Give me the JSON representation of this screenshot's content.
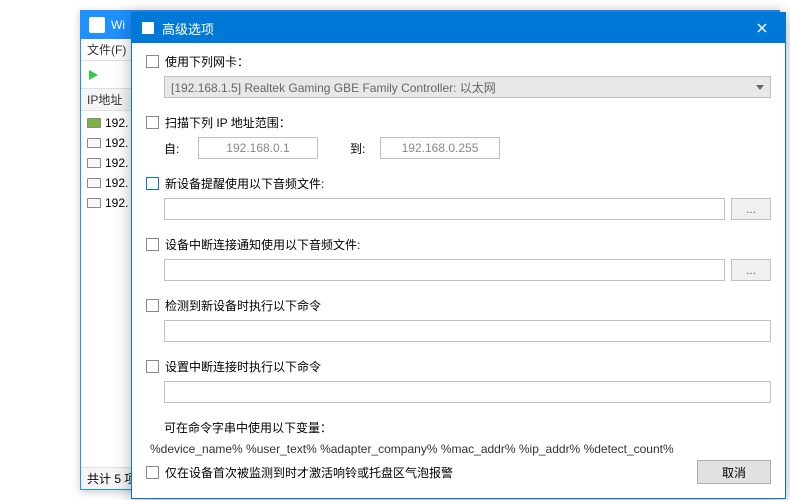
{
  "bg": {
    "title": "Wi",
    "menu": "文件(F)",
    "header": "IP地址",
    "rows": [
      "192.",
      "192.",
      "192.",
      "192.",
      "192."
    ],
    "status": "共计 5 项"
  },
  "dialog": {
    "title": "高级选项",
    "opts": {
      "useAdapter": "使用下列网卡：",
      "adapter": "[192.168.1.5]  Realtek Gaming GBE Family Controller:  以太网",
      "scanRange": "扫描下列 IP 地址范围：",
      "from": "自:",
      "fromVal": "192.168.0.1",
      "to": "到:",
      "toVal": "192.168.0.255",
      "newDevAudio": "新设备提醒使用以下音频文件:",
      "disconnectAudio": "设备中断连接通知使用以下音频文件:",
      "newDevCmd": "检测到新设备时执行以下命令",
      "disconnectCmd": "设置中断连接时执行以下命令",
      "varsLabel": "可在命令字串中使用以下变量：",
      "vars": "%device_name%  %user_text%  %adapter_company%  %mac_addr%  %ip_addr%  %detect_count%",
      "firstDetect": "仅在设备首次被监测到时才激活响铃或托盘区气泡报警"
    },
    "browse": "...",
    "cancel": "取消"
  }
}
